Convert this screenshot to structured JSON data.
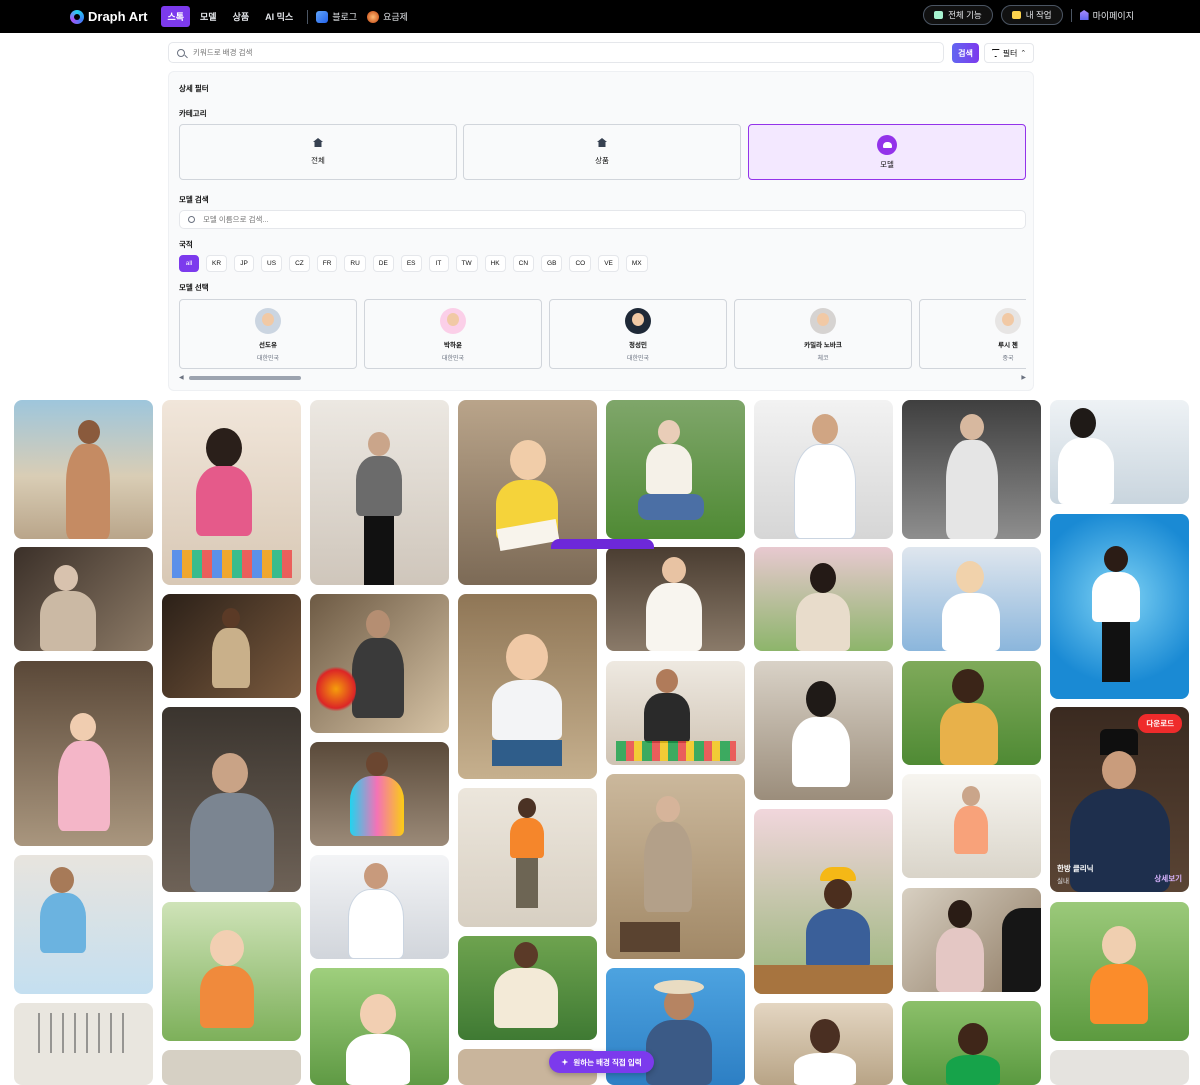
{
  "brand": {
    "name": "Draph Art"
  },
  "nav": {
    "items": [
      {
        "label": "스톡",
        "active": true
      },
      {
        "label": "모델",
        "active": false
      },
      {
        "label": "상품",
        "active": false
      },
      {
        "label": "AI 믹스",
        "active": false
      }
    ],
    "links": [
      {
        "label": "블로그",
        "icon": "book-icon"
      },
      {
        "label": "요금제",
        "icon": "coin-icon"
      }
    ],
    "right": {
      "all_features": "전체 기능",
      "my_work": "내 작업",
      "mypage": "마이페이지"
    }
  },
  "search": {
    "placeholder": "키워드로 배경 검색",
    "button": "검색",
    "filter_label": "필터"
  },
  "filter_panel": {
    "title": "상세 필터",
    "category_label": "카테고리",
    "categories": [
      {
        "label": "전체",
        "icon": "home-icon",
        "active": false
      },
      {
        "label": "상품",
        "icon": "home-icon",
        "active": false
      },
      {
        "label": "모델",
        "icon": "people-icon",
        "active": true
      }
    ],
    "model_search_label": "모델 검색",
    "model_search_placeholder": "모델 이름으로 검색...",
    "nationality_label": "국적",
    "nationalities": [
      "all",
      "KR",
      "JP",
      "US",
      "CZ",
      "FR",
      "RU",
      "DE",
      "ES",
      "IT",
      "TW",
      "HK",
      "CN",
      "GB",
      "CO",
      "VE",
      "MX"
    ],
    "nationality_selected": "all",
    "model_select_label": "모델 선택",
    "models": [
      {
        "name": "선도유",
        "country": "대한민국"
      },
      {
        "name": "박하윤",
        "country": "대한민국"
      },
      {
        "name": "정성민",
        "country": "대한민국"
      },
      {
        "name": "카밀라 노바크",
        "country": "체코"
      },
      {
        "name": "루시 첸",
        "country": "중국"
      }
    ]
  },
  "gallery": {
    "featured": {
      "badge": "다운로드",
      "caption": "한방 클리닉",
      "sub": "실내",
      "more": "상세보기"
    },
    "cta": "원하는 배경 직접 입력"
  },
  "colors": {
    "accent": "#7c3aed",
    "download_badge": "#ef2b2b",
    "active_card_bg": "#f3e8ff"
  }
}
